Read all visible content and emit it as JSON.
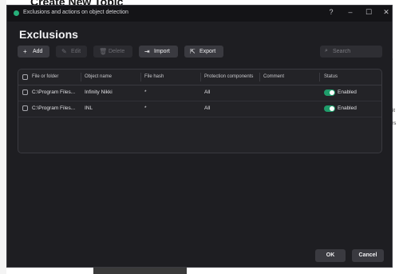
{
  "background": {
    "page_title": "Create New Topic"
  },
  "window": {
    "title": "Exclusions and actions on object detection",
    "help_glyph": "?",
    "minimize_glyph": "–",
    "maximize_glyph": "☐",
    "close_glyph": "✕"
  },
  "heading": "Exclusions",
  "toolbar": {
    "add": {
      "label": "Add",
      "icon": "plus-icon",
      "glyph": "+"
    },
    "edit": {
      "label": "Edit",
      "icon": "pencil-icon",
      "glyph": "✎"
    },
    "delete": {
      "label": "Delete",
      "icon": "trash-icon",
      "glyph": "🗑"
    },
    "import": {
      "label": "Import",
      "icon": "import-icon",
      "glyph": "⇥"
    },
    "export": {
      "label": "Export",
      "icon": "export-icon",
      "glyph": "⇱"
    }
  },
  "search": {
    "placeholder": "Search",
    "value": "",
    "icon": "search-icon",
    "glyph": "⌕"
  },
  "table": {
    "columns": [
      "File or folder",
      "Object name",
      "File hash",
      "Protection components",
      "Comment",
      "Status"
    ],
    "rows": [
      {
        "file": "C:\\Program Files...",
        "object": "Infinity Nikki",
        "hash": "*",
        "protection": "All",
        "comment": "",
        "status": "Enabled"
      },
      {
        "file": "C:\\Program Files...",
        "object": "INL",
        "hash": "*",
        "protection": "All",
        "comment": "",
        "status": "Enabled"
      }
    ]
  },
  "footer": {
    "ok": "OK",
    "cancel": "Cancel"
  },
  "colors": {
    "accent": "#1f9d6b",
    "dialog_bg": "#1e1e22"
  }
}
